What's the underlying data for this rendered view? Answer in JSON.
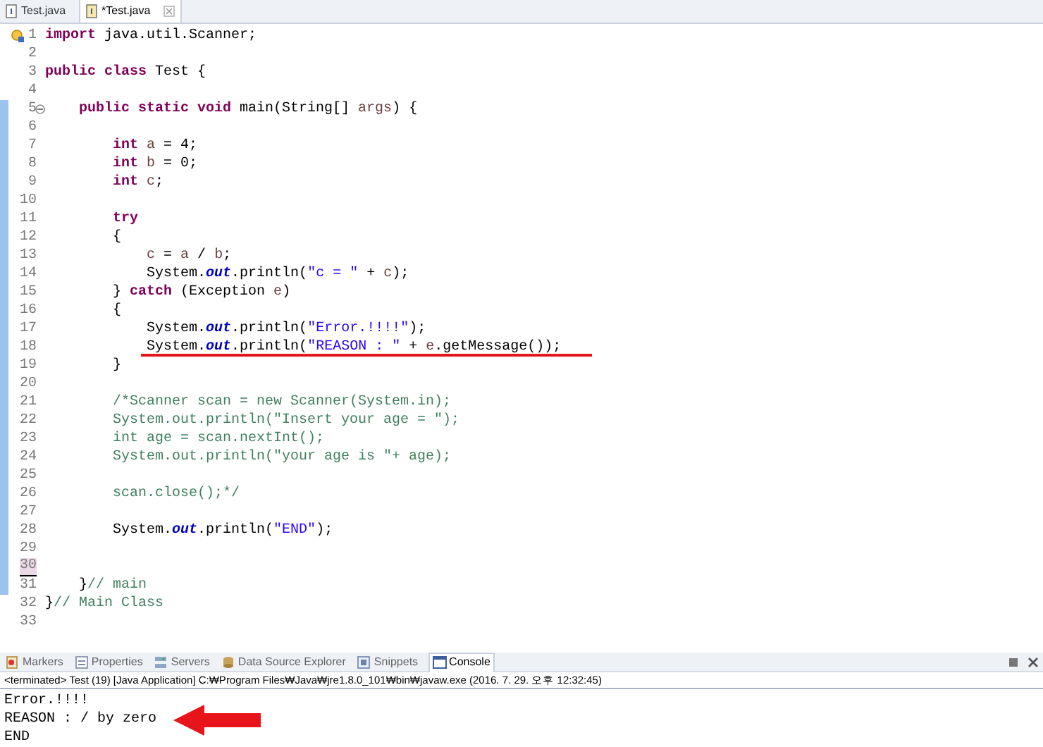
{
  "editor_tabs": [
    {
      "label": "Test.java",
      "selected": false
    },
    {
      "label": "*Test.java",
      "selected": true
    }
  ],
  "code_lines": [
    {
      "number": "1",
      "kind": "warning",
      "changed": false,
      "current": false,
      "underlined": false,
      "tokens": [
        {
          "kind": "keyword",
          "text": "import"
        },
        {
          "kind": "plain",
          "text": " java.util.Scanner;"
        }
      ]
    },
    {
      "number": "2",
      "kind": "code",
      "changed": false,
      "current": false,
      "underlined": false
    },
    {
      "number": "3",
      "kind": "code",
      "changed": false,
      "current": false,
      "underlined": false,
      "tokens": [
        {
          "kind": "keyword",
          "text": "public class"
        },
        {
          "kind": "plain",
          "text": " Test {"
        }
      ]
    },
    {
      "number": "4",
      "kind": "code",
      "changed": false,
      "current": false,
      "underlined": false
    },
    {
      "number": "5",
      "kind": "fold",
      "changed": true,
      "current": false,
      "underlined": false,
      "tokens": [
        {
          "kind": "keyword",
          "text": "    public static void"
        },
        {
          "kind": "plain",
          "text": " main(String[] "
        },
        {
          "kind": "variable",
          "text": "args"
        },
        {
          "kind": "plain",
          "text": ") {"
        }
      ]
    },
    {
      "number": "6",
      "kind": "code",
      "changed": true,
      "current": false,
      "underlined": false
    },
    {
      "number": "7",
      "kind": "code",
      "changed": true,
      "current": false,
      "underlined": false,
      "tokens": [
        {
          "kind": "keyword",
          "text": "        int"
        },
        {
          "kind": "variable",
          "text": " a"
        },
        {
          "kind": "plain",
          "text": " = 4;"
        }
      ]
    },
    {
      "number": "8",
      "kind": "code",
      "changed": true,
      "current": false,
      "underlined": false,
      "tokens": [
        {
          "kind": "keyword",
          "text": "        int"
        },
        {
          "kind": "variable",
          "text": " b"
        },
        {
          "kind": "plain",
          "text": " = 0;"
        }
      ]
    },
    {
      "number": "9",
      "kind": "code",
      "changed": true,
      "current": false,
      "underlined": false,
      "tokens": [
        {
          "kind": "keyword",
          "text": "        int"
        },
        {
          "kind": "variable",
          "text": " c"
        },
        {
          "kind": "plain",
          "text": ";"
        }
      ]
    },
    {
      "number": "10",
      "kind": "code",
      "changed": true,
      "current": false,
      "underlined": false
    },
    {
      "number": "11",
      "kind": "code",
      "changed": true,
      "current": false,
      "underlined": false,
      "tokens": [
        {
          "kind": "keyword",
          "text": "        try"
        }
      ]
    },
    {
      "number": "12",
      "kind": "code",
      "changed": true,
      "current": false,
      "underlined": false,
      "tokens": [
        {
          "kind": "plain",
          "text": "        {"
        }
      ]
    },
    {
      "number": "13",
      "kind": "code",
      "changed": true,
      "current": false,
      "underlined": false,
      "tokens": [
        {
          "kind": "variable",
          "text": "            c"
        },
        {
          "kind": "plain",
          "text": " = "
        },
        {
          "kind": "variable",
          "text": "a"
        },
        {
          "kind": "plain",
          "text": " / "
        },
        {
          "kind": "variable",
          "text": "b"
        },
        {
          "kind": "plain",
          "text": ";"
        }
      ]
    },
    {
      "number": "14",
      "kind": "code",
      "changed": true,
      "current": false,
      "underlined": false,
      "tokens": [
        {
          "kind": "plain",
          "text": "            System."
        },
        {
          "kind": "field",
          "text": "out"
        },
        {
          "kind": "plain",
          "text": ".println("
        },
        {
          "kind": "string",
          "text": "\"c = \""
        },
        {
          "kind": "plain",
          "text": " + "
        },
        {
          "kind": "variable",
          "text": "c"
        },
        {
          "kind": "plain",
          "text": ");"
        }
      ]
    },
    {
      "number": "15",
      "kind": "code",
      "changed": true,
      "current": false,
      "underlined": false,
      "tokens": [
        {
          "kind": "plain",
          "text": "        } "
        },
        {
          "kind": "keyword",
          "text": "catch"
        },
        {
          "kind": "plain",
          "text": " (Exception "
        },
        {
          "kind": "variable",
          "text": "e"
        },
        {
          "kind": "plain",
          "text": ")"
        }
      ]
    },
    {
      "number": "16",
      "kind": "code",
      "changed": true,
      "current": false,
      "underlined": false,
      "tokens": [
        {
          "kind": "plain",
          "text": "        {"
        }
      ]
    },
    {
      "number": "17",
      "kind": "code",
      "changed": true,
      "current": false,
      "underlined": false,
      "tokens": [
        {
          "kind": "plain",
          "text": "            System."
        },
        {
          "kind": "field",
          "text": "out"
        },
        {
          "kind": "plain",
          "text": ".println("
        },
        {
          "kind": "string",
          "text": "\"Error.!!!!\""
        },
        {
          "kind": "plain",
          "text": ");"
        }
      ]
    },
    {
      "number": "18",
      "kind": "code",
      "changed": true,
      "current": false,
      "underlined": true,
      "tokens": [
        {
          "kind": "plain",
          "text": "            System."
        },
        {
          "kind": "field",
          "text": "out"
        },
        {
          "kind": "plain",
          "text": ".println("
        },
        {
          "kind": "string",
          "text": "\"REASON : \""
        },
        {
          "kind": "plain",
          "text": " + "
        },
        {
          "kind": "variable",
          "text": "e"
        },
        {
          "kind": "plain",
          "text": ".getMessage());"
        }
      ]
    },
    {
      "number": "19",
      "kind": "code",
      "changed": true,
      "current": false,
      "underlined": false,
      "tokens": [
        {
          "kind": "plain",
          "text": "        }"
        }
      ]
    },
    {
      "number": "20",
      "kind": "code",
      "changed": true,
      "current": false,
      "underlined": false
    },
    {
      "number": "21",
      "kind": "code",
      "changed": true,
      "current": false,
      "underlined": false,
      "tokens": [
        {
          "kind": "comment",
          "text": "        /*Scanner scan = new Scanner(System.in);"
        }
      ]
    },
    {
      "number": "22",
      "kind": "code",
      "changed": true,
      "current": false,
      "underlined": false,
      "tokens": [
        {
          "kind": "comment",
          "text": "        System.out.println(\"Insert your age = \");"
        }
      ]
    },
    {
      "number": "23",
      "kind": "code",
      "changed": true,
      "current": false,
      "underlined": false,
      "tokens": [
        {
          "kind": "comment",
          "text": "        int age = scan.nextInt();"
        }
      ]
    },
    {
      "number": "24",
      "kind": "code",
      "changed": true,
      "current": false,
      "underlined": false,
      "tokens": [
        {
          "kind": "comment",
          "text": "        System.out.println(\"your age is \"+ age);"
        }
      ]
    },
    {
      "number": "25",
      "kind": "code",
      "changed": true,
      "current": false,
      "underlined": false
    },
    {
      "number": "26",
      "kind": "code",
      "changed": true,
      "current": false,
      "underlined": false,
      "tokens": [
        {
          "kind": "comment",
          "text": "        scan.close();*/"
        }
      ]
    },
    {
      "number": "27",
      "kind": "code",
      "changed": true,
      "current": false,
      "underlined": false
    },
    {
      "number": "28",
      "kind": "code",
      "changed": true,
      "current": false,
      "underlined": false,
      "tokens": [
        {
          "kind": "plain",
          "text": "        System."
        },
        {
          "kind": "field",
          "text": "out"
        },
        {
          "kind": "plain",
          "text": ".println("
        },
        {
          "kind": "string",
          "text": "\"END\""
        },
        {
          "kind": "plain",
          "text": ");"
        }
      ]
    },
    {
      "number": "29",
      "kind": "code",
      "changed": true,
      "current": false,
      "underlined": false
    },
    {
      "number": "30",
      "kind": "code",
      "changed": true,
      "current": true,
      "underlined": false
    },
    {
      "number": "31",
      "kind": "code",
      "changed": true,
      "current": false,
      "underlined": false,
      "tokens": [
        {
          "kind": "plain",
          "text": "    }"
        },
        {
          "kind": "comment",
          "text": "// main"
        }
      ]
    },
    {
      "number": "32",
      "kind": "code",
      "changed": false,
      "current": false,
      "underlined": false,
      "tokens": [
        {
          "kind": "plain",
          "text": "}"
        },
        {
          "kind": "comment",
          "text": "// Main Class"
        }
      ]
    },
    {
      "number": "33",
      "kind": "code",
      "changed": false,
      "current": false,
      "underlined": false
    }
  ],
  "view_tabs": [
    {
      "label": "Markers",
      "selected": false
    },
    {
      "label": "Properties",
      "selected": false
    },
    {
      "label": "Servers",
      "selected": false
    },
    {
      "label": "Data Source Explorer",
      "selected": false
    },
    {
      "label": "Snippets",
      "selected": false
    },
    {
      "label": "Console",
      "selected": true
    }
  ],
  "console": {
    "header": "<terminated> Test (19) [Java Application] C:₩Program Files₩Java₩jre1.8.0_101₩bin₩javaw.exe (2016. 7. 29. 오후 12:32:45)",
    "lines": [
      {
        "text": "Error.!!!!",
        "arrow": false
      },
      {
        "text": "REASON : / by zero",
        "arrow": true
      },
      {
        "text": "END",
        "arrow": false
      }
    ]
  }
}
